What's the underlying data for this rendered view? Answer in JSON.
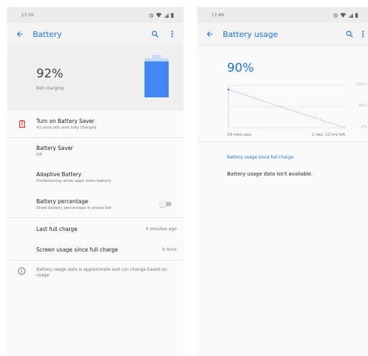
{
  "left": {
    "status_time": "17:20",
    "title": "Battery",
    "battery_percent": "92%",
    "charging_status": "Not charging",
    "saver_suggestion": {
      "title": "Turn on Battery Saver",
      "subtitle": "41 mins left until fully charged"
    },
    "battery_saver": {
      "title": "Battery Saver",
      "subtitle": "Off"
    },
    "adaptive_battery": {
      "title": "Adaptive Battery",
      "subtitle": "On/detecting when apps drain battery"
    },
    "battery_percentage": {
      "title": "Battery percentage",
      "subtitle": "Show battery percentage in status bar",
      "enabled": false
    },
    "last_full_charge": {
      "label": "Last full charge",
      "value": "0 minutes ago"
    },
    "screen_usage": {
      "label": "Screen usage since full charge",
      "value": "0 mins"
    },
    "info_note": "Battery usage data is approximate and can change based on usage",
    "battery_level": 0.92,
    "colors": {
      "accent": "#1a73e8",
      "battery_fill": "#4285f4",
      "saver_icon": "#d93025"
    }
  },
  "right": {
    "status_time": "17:49",
    "title": "Battery usage",
    "battery_percent": "90%",
    "chart_data": {
      "type": "line",
      "x": [
        "29 mins ago",
        "1 day, 12 hrs left"
      ],
      "series": [
        {
          "values": [
            90,
            0
          ],
          "style": "projected-dashed"
        }
      ],
      "y_ticks": [
        "100%",
        "50%",
        "0%"
      ],
      "ylim": [
        0,
        100
      ],
      "grid": true
    },
    "section_title": "Battery usage since full charge",
    "section_text": "Battery usage data isn't available."
  }
}
